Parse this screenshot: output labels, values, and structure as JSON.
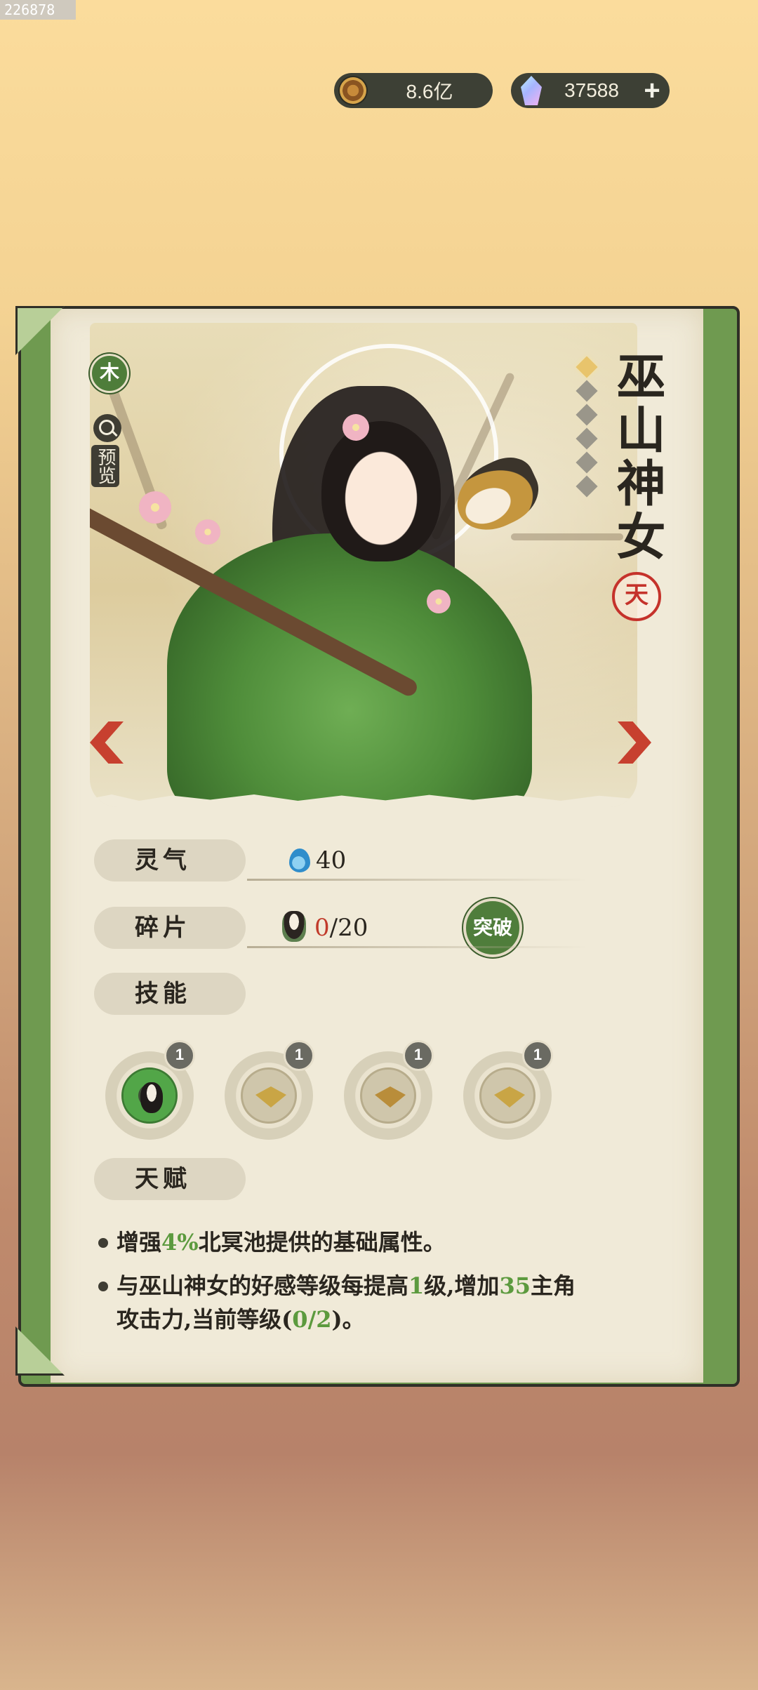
{
  "id_tag": "226878",
  "currency": {
    "coins": "8.6亿",
    "gems": "37588",
    "plus_label": "+"
  },
  "character": {
    "element": "木",
    "preview_label": "预览",
    "name": "巫山神女",
    "rank": "天",
    "stars_total": 6,
    "stars_lit": 1
  },
  "stats": {
    "spirit_label": "灵气",
    "spirit_value": "40",
    "shard_label": "碎片",
    "shard_current": "0",
    "shard_total": "/20",
    "break_button": "突破",
    "skills_label": "技能",
    "talent_label": "天赋"
  },
  "skills": [
    {
      "name": "character-skill",
      "level": "1"
    },
    {
      "name": "farm-skill",
      "level": "1"
    },
    {
      "name": "hoe-skill",
      "level": "1"
    },
    {
      "name": "seedling-skill",
      "level": "1"
    }
  ],
  "talents": {
    "t1_pre": "增强",
    "t1_num": "4%",
    "t1_post": "北冥池提供的基础属性。",
    "t2_pre": "与巫山神女的好感等级每提高",
    "t2_num1": "1",
    "t2_mid": "级,增加",
    "t2_num2": "35",
    "t2_mid2": "主角攻击力,当前等级(",
    "t2_num3": "0/2",
    "t2_post": ")。"
  },
  "colors": {
    "card_green": "#6f9a50",
    "paper": "#f0ead8",
    "accent_red": "#c13a2a",
    "talent_green": "#5c9a3e"
  }
}
